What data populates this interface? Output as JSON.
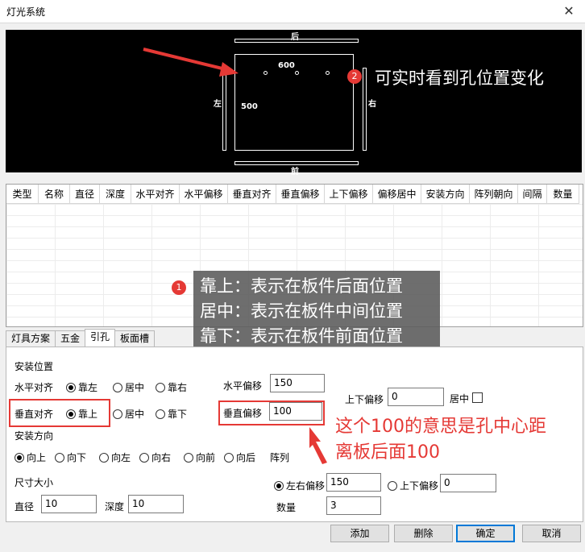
{
  "window": {
    "title": "灯光系统",
    "close_glyph": "✕"
  },
  "preview": {
    "label_back": "后",
    "label_front": "前",
    "label_left": "左",
    "label_right": "右",
    "dim_600": "600",
    "dim_500": "500",
    "annotation_text": "可实时看到孔位置变化",
    "annotation_badge": "2"
  },
  "grid": {
    "columns": [
      "类型",
      "名称",
      "直径",
      "深度",
      "水平对齐",
      "水平偏移",
      "垂直对齐",
      "垂直偏移",
      "上下偏移",
      "偏移居中",
      "安装方向",
      "阵列朝向",
      "间隔",
      "数量"
    ]
  },
  "callout1": {
    "badge": "1",
    "lines": [
      "靠上：表示在板件后面位置",
      "居中：表示在板件中间位置",
      "靠下：表示在板件前面位置"
    ]
  },
  "tabs": [
    "灯具方案",
    "五金",
    "引孔",
    "板面槽"
  ],
  "form": {
    "section_install_pos": "安装位置",
    "h_align_label": "水平对齐",
    "h_align_options": [
      "靠左",
      "居中",
      "靠右"
    ],
    "h_offset_label": "水平偏移",
    "h_offset_value": "150",
    "ud_offset_label": "上下偏移",
    "ud_offset_value": "0",
    "center_label": "居中",
    "v_align_label": "垂直对齐",
    "v_align_options": [
      "靠上",
      "居中",
      "靠下"
    ],
    "v_offset_label": "垂直偏移",
    "v_offset_value": "100",
    "section_install_dir": "安装方向",
    "dir_options": [
      "向上",
      "向下",
      "向左",
      "向右",
      "向前",
      "向后"
    ],
    "array_label": "阵列",
    "section_size": "尺寸大小",
    "diameter_label": "直径",
    "diameter_value": "10",
    "depth_label": "深度",
    "depth_value": "10",
    "lr_offset_label": "左右偏移",
    "lr_offset_value": "150",
    "ud2_offset_label": "上下偏移",
    "ud2_offset_value": "0",
    "count_label": "数量",
    "count_value": "3"
  },
  "annotation3": {
    "lines": [
      "这个100的意思是孔中心距",
      "离板后面100"
    ]
  },
  "buttons": {
    "add": "添加",
    "delete": "删除",
    "ok": "确定",
    "cancel": "取消"
  },
  "colors": {
    "accent_red": "#e53935",
    "focus_blue": "#0078d7"
  }
}
